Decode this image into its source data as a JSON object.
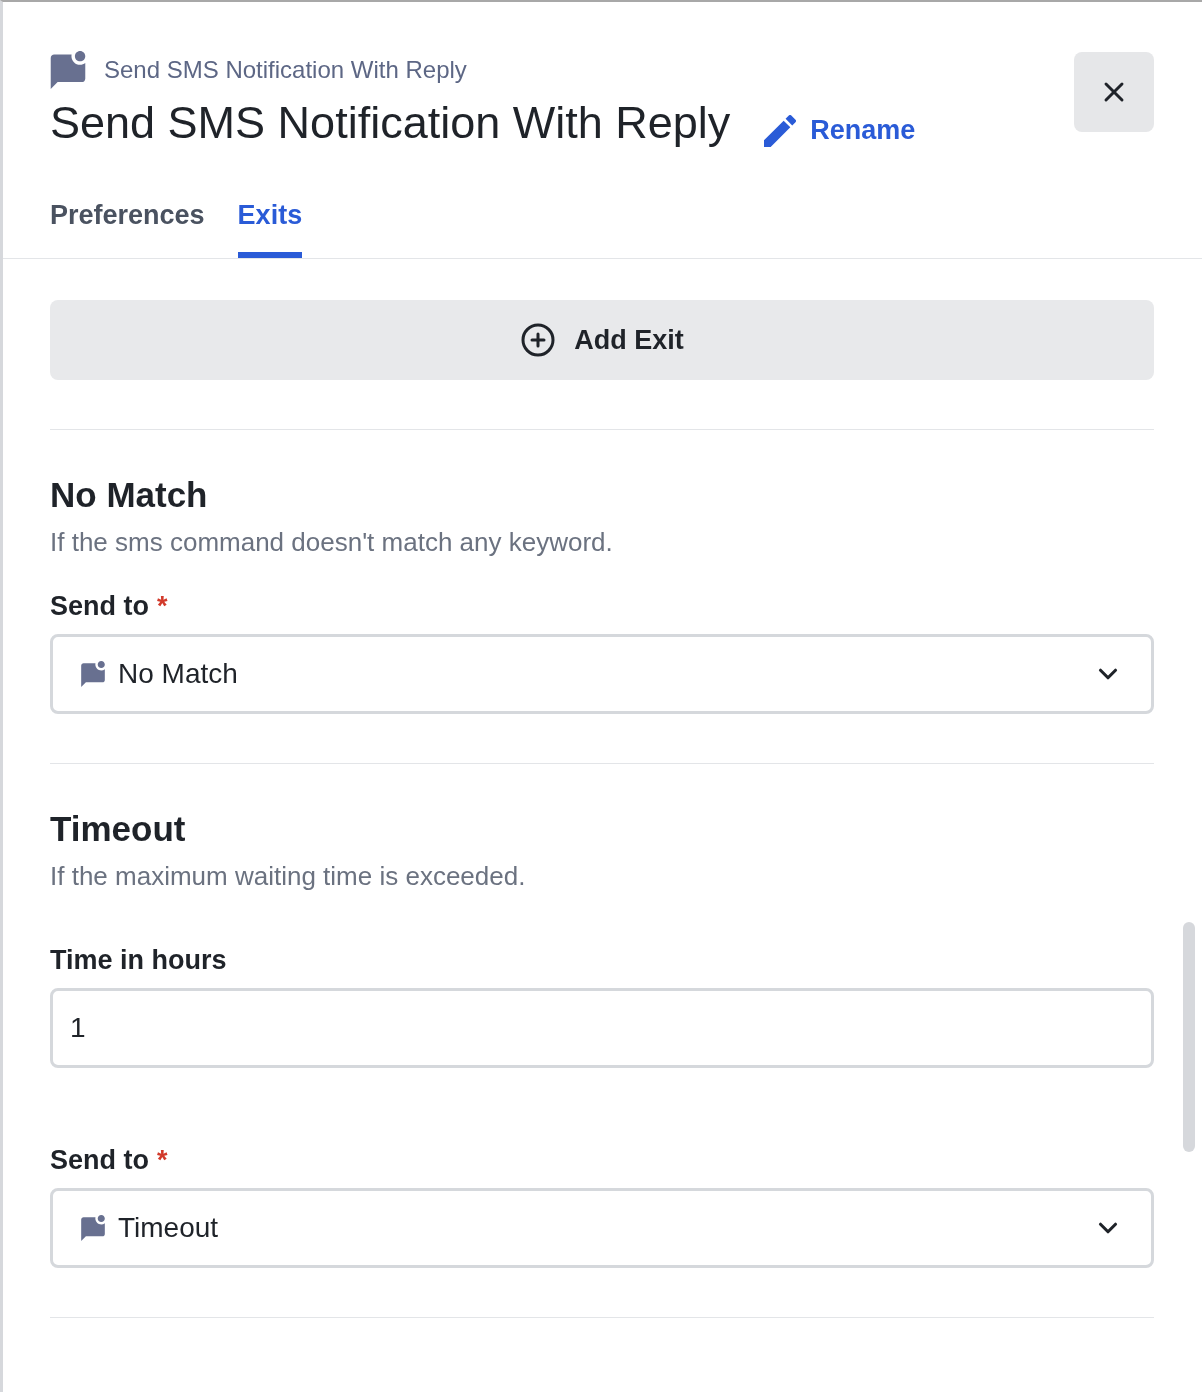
{
  "header": {
    "subtitle": "Send SMS Notification With Reply",
    "title": "Send SMS Notification With Reply",
    "rename_link": "Rename"
  },
  "tabs": [
    {
      "label": "Preferences",
      "selected": false
    },
    {
      "label": "Exits",
      "selected": true
    }
  ],
  "add_exit_button": "Add Exit",
  "exits": [
    {
      "heading": "No Match",
      "description": "If the sms command doesn't match any keyword.",
      "fields": [
        {
          "kind": "select",
          "label": "Send to",
          "required_mark": "*",
          "value": "No Match"
        }
      ]
    },
    {
      "heading": "Timeout",
      "description": "If the maximum waiting time is exceeded.",
      "fields": [
        {
          "kind": "input",
          "label": "Time in hours",
          "value": "1"
        },
        {
          "kind": "select",
          "label": "Send to",
          "required_mark": "*",
          "value": "Timeout"
        }
      ]
    }
  ]
}
